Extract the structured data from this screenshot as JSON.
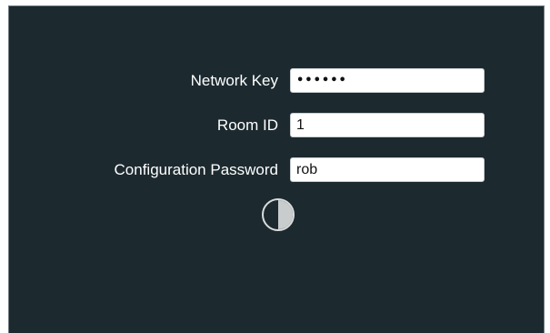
{
  "form": {
    "network_key": {
      "label": "Network Key",
      "value": "••••••"
    },
    "room_id": {
      "label": "Room ID",
      "value": "1"
    },
    "config_password": {
      "label": "Configuration Password",
      "value": "rob"
    }
  },
  "status": {
    "icon": "half-circle-contrast-icon",
    "color_light": "#ffffff",
    "color_dark": "#1c2a30"
  },
  "theme": {
    "background": "#1c2a30",
    "text": "#ffffff",
    "input_background": "#ffffff"
  }
}
